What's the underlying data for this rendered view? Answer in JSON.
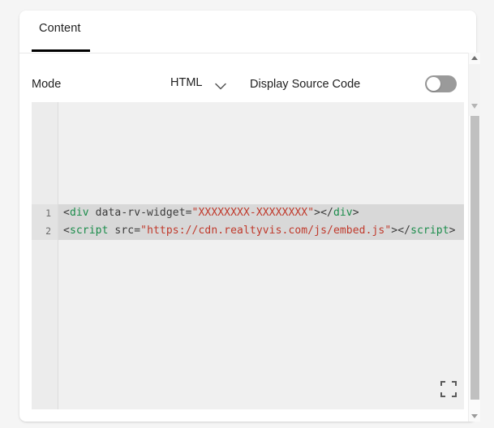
{
  "card": {
    "tabs": [
      {
        "label": "Content",
        "active": true
      }
    ]
  },
  "controls": {
    "mode_label": "Mode",
    "mode_value": "HTML",
    "mode_options": [
      "HTML"
    ],
    "chevron_icon": "chevron-down-icon",
    "display_source_label": "Display Source Code",
    "display_source_enabled": false
  },
  "editor": {
    "language": "html",
    "fullscreen_icon": "fullscreen-icon",
    "lines": [
      {
        "number": "1",
        "tokens": [
          {
            "text": "<",
            "type": "punct"
          },
          {
            "text": "div",
            "type": "tag"
          },
          {
            "text": " data-rv-widget=",
            "type": "attr"
          },
          {
            "text": "\"XXXXXXXX-XXXXXXXX\"",
            "type": "str"
          },
          {
            "text": "></",
            "type": "punct"
          },
          {
            "text": "div",
            "type": "tag"
          },
          {
            "text": ">",
            "type": "punct"
          }
        ]
      },
      {
        "number": "2",
        "tokens": [
          {
            "text": "<",
            "type": "punct"
          },
          {
            "text": "script",
            "type": "tag"
          },
          {
            "text": " src=",
            "type": "attr"
          },
          {
            "text": "\"https://cdn.realtyvis.com/js/embed.js\"",
            "type": "str"
          },
          {
            "text": "></",
            "type": "punct"
          },
          {
            "text": "script",
            "type": "tag"
          },
          {
            "text": ">",
            "type": "punct"
          }
        ]
      }
    ]
  },
  "scrollbar": {
    "up_arrow_icon": "scroll-up-arrow-icon",
    "down_arrow_icon": "scroll-down-arrow-icon",
    "mid_arrow_icon": "scroll-mid-arrow-icon"
  },
  "colors": {
    "accent": "#000000",
    "tag": "#1a8c4a",
    "string": "#c0392b",
    "punct": "#3b3b3b",
    "editor_bg": "#f0f0f0",
    "line_highlight": "#d8d8d8"
  }
}
